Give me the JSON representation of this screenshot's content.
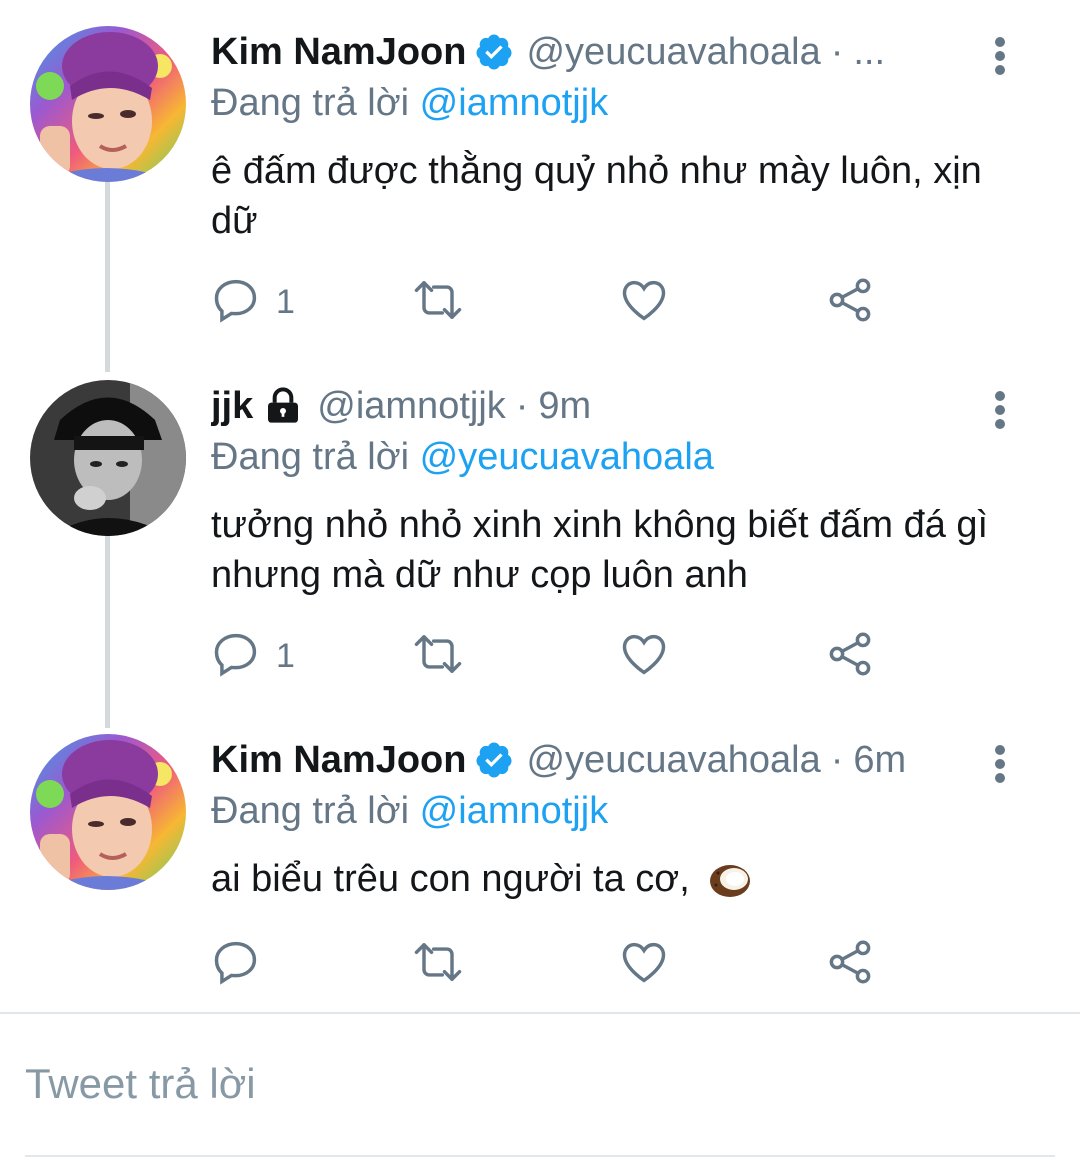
{
  "tweets": [
    {
      "name": "Kim NamJoon",
      "verified": true,
      "handle": "@yeucuavahoala",
      "separator": "·",
      "time": "...",
      "reply_prefix": "Đang trả lời",
      "reply_to": "@iamnotjjk",
      "text": "ê đấm được thằng quỷ nhỏ như mày luôn, xịn dữ",
      "reply_count": "1",
      "avatar_icon": "rainbow-portrait-avatar"
    },
    {
      "name": "jjk",
      "locked": true,
      "handle": "@iamnotjjk",
      "separator": "·",
      "time": "9m",
      "reply_prefix": "Đang trả lời",
      "reply_to": "@yeucuavahoala",
      "text": "tưởng nhỏ nhỏ xinh xinh không biết đấm đá gì nhưng mà dữ như cọp luôn anh",
      "reply_count": "1",
      "avatar_icon": "monochrome-portrait-avatar"
    },
    {
      "name": "Kim NamJoon",
      "verified": true,
      "handle": "@yeucuavahoala",
      "separator": "·",
      "time": "6m",
      "reply_prefix": "Đang trả lời",
      "reply_to": "@iamnotjjk",
      "text": "ai biểu trêu con người ta cơ,",
      "emoji_icon": "coconut-emoji",
      "reply_count": "",
      "avatar_icon": "rainbow-portrait-avatar"
    }
  ],
  "compose": {
    "placeholder": "Tweet trả lời"
  },
  "colors": {
    "accent": "#1da1f2",
    "secondary_text": "#657786",
    "primary_text": "#14171a",
    "thread_line": "#d4d9dd"
  },
  "icons": [
    "reply-icon",
    "retweet-icon",
    "like-icon",
    "share-icon",
    "more-icon",
    "verified-badge-icon",
    "lock-icon"
  ]
}
